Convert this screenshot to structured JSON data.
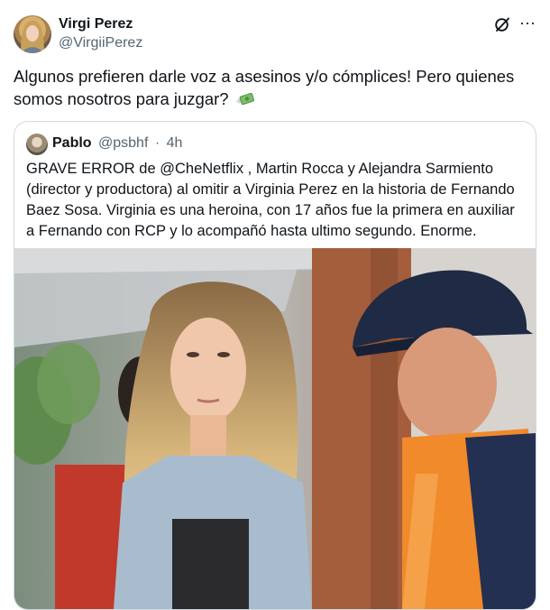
{
  "author": {
    "display_name": "Virgi Perez",
    "handle": "@VirgiiPerez",
    "avatar_icon": "profile-photo-avatar"
  },
  "header_icons": [
    "grok-icon",
    "more-icon"
  ],
  "more_glyph": "···",
  "tweet": {
    "text": "Algunos prefieren darle voz a asesinos y/o cómplices! Pero quienes somos nosotros para juzgar?",
    "emoji": "money-with-wings-emoji"
  },
  "quoted": {
    "display_name": "Pablo",
    "handle": "@psbhf",
    "separator": "·",
    "time": "4h",
    "text": "GRAVE ERROR de @CheNetflix , Martin Rocca y Alejandra Sarmiento (director y productora) al omitir a Virginia Perez en la historia de Fernando Baez Sosa. Virginia es una heroina, con 17 años fue la primera en auxiliar a Fernando con RCP y lo acompañó hasta ultimo segundo. Enorme."
  },
  "colors": {
    "text": "#0f1419",
    "secondary": "#536471",
    "border": "#cfd9de",
    "vest": "#f08a2a",
    "cap": "#1f2a44"
  }
}
